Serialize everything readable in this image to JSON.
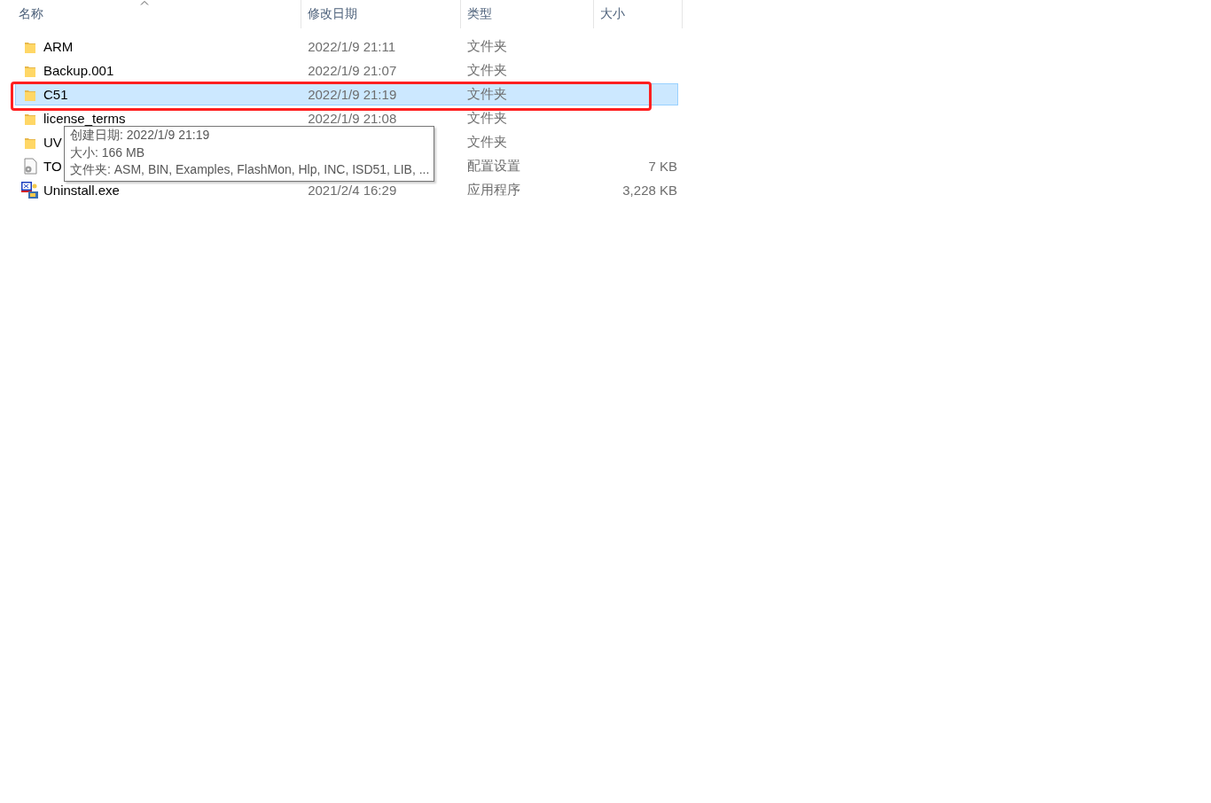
{
  "columns": [
    {
      "label": "名称",
      "sorted": true
    },
    {
      "label": "修改日期",
      "sorted": false
    },
    {
      "label": "类型",
      "sorted": false
    },
    {
      "label": "大小",
      "sorted": false
    }
  ],
  "rows": [
    {
      "name": "ARM",
      "date": "2022/1/9 21:11",
      "type": "文件夹",
      "kind": "folder",
      "selected": false
    },
    {
      "name": "Backup.001",
      "date": "2022/1/9 21:07",
      "type": "文件夹",
      "kind": "folder",
      "selected": false
    },
    {
      "name": "C51",
      "date": "2022/1/9 21:19",
      "type": "文件夹",
      "kind": "folder",
      "selected": true,
      "highlighted": true
    },
    {
      "name": "license_terms",
      "date": "2022/1/9 21:08",
      "type": "文件夹",
      "kind": "folder",
      "selected": false
    },
    {
      "name": "UV",
      "type": "文件夹",
      "kind": "folder",
      "selected": false
    },
    {
      "name": "TO",
      "type": "配置设置",
      "size": "7 KB",
      "kind": "config",
      "selected": false
    },
    {
      "name": "Uninstall.exe",
      "date": "2021/2/4 16:29",
      "type": "应用程序",
      "size": "3,228 KB",
      "kind": "exe",
      "selected": false
    }
  ],
  "tooltip": {
    "lines": [
      "创建日期: 2022/1/9 21:19",
      "大小: 166 MB",
      "文件夹: ASM, BIN, Examples, FlashMon, Hlp, INC, ISD51, LIB, ..."
    ]
  }
}
